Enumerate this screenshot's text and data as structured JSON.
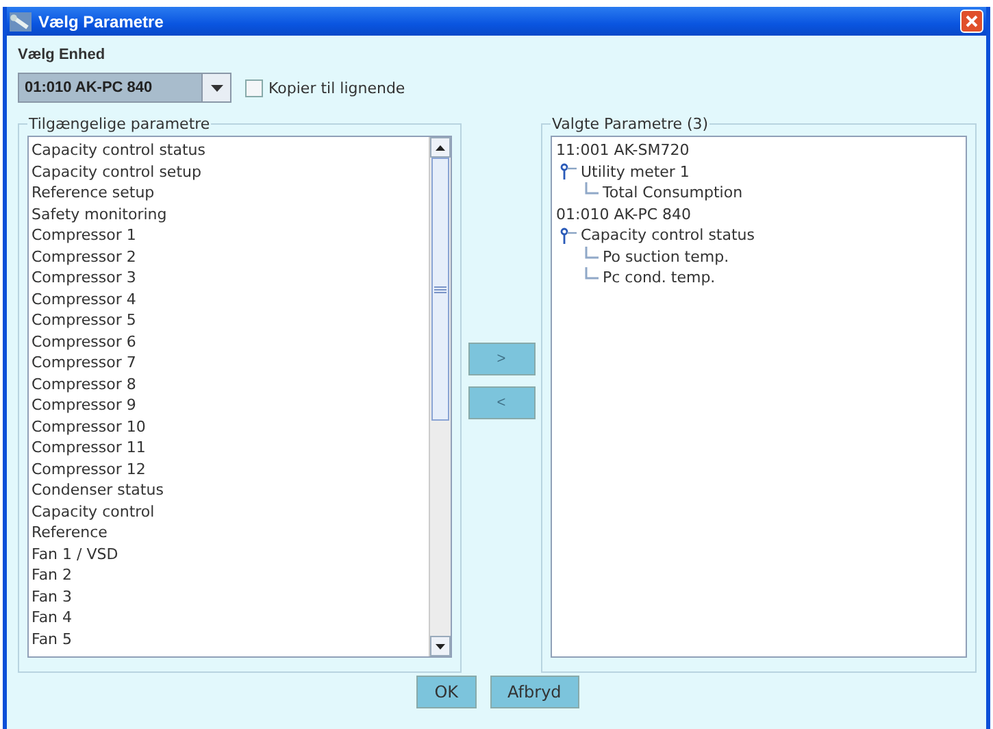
{
  "window": {
    "title": "Vælg Parametre"
  },
  "device": {
    "label": "Vælg Enhed",
    "value": "01:010 AK-PC 840",
    "copy_checkbox": {
      "label": "Kopier til lignende",
      "checked": false
    }
  },
  "available": {
    "title": "Tilgængelige parametre",
    "items": [
      {
        "label": "Capacity control status",
        "selected": false
      },
      {
        "label": "Capacity control setup",
        "selected": false
      },
      {
        "label": "Reference setup",
        "selected": false
      },
      {
        "label": "Safety monitoring",
        "selected": false
      },
      {
        "label": "Compressor 1",
        "selected": false
      },
      {
        "label": "Compressor 2",
        "selected": false
      },
      {
        "label": "Compressor 3",
        "selected": false
      },
      {
        "label": "Compressor 4",
        "selected": false
      },
      {
        "label": "Compressor 5",
        "selected": false
      },
      {
        "label": "Compressor 6",
        "selected": false
      },
      {
        "label": "Compressor 7",
        "selected": false
      },
      {
        "label": "Compressor 8",
        "selected": false
      },
      {
        "label": "Compressor 9",
        "selected": false
      },
      {
        "label": "Compressor 10",
        "selected": false
      },
      {
        "label": "Compressor 11",
        "selected": false
      },
      {
        "label": "Compressor 12",
        "selected": false
      },
      {
        "label": "Condenser status",
        "selected": false
      },
      {
        "label": "Capacity control",
        "selected": false
      },
      {
        "label": "Reference",
        "selected": false
      },
      {
        "label": "Fan 1 / VSD",
        "selected": false
      },
      {
        "label": "Fan 2",
        "selected": false
      },
      {
        "label": "Fan 3",
        "selected": false
      },
      {
        "label": "Fan 4",
        "selected": false
      },
      {
        "label": "Fan 5",
        "selected": false
      }
    ]
  },
  "move_buttons": [
    {
      "label": ">",
      "disabled": true
    },
    {
      "label": "<",
      "disabled": true
    }
  ],
  "chosen": {
    "title": "Valgte Parametre (3)",
    "tree": [
      {
        "label": "11:001 AK-SM720",
        "children": [
          {
            "label": "Utility meter 1",
            "expanded": true,
            "children": [
              {
                "label": "Total Consumption"
              }
            ]
          }
        ]
      },
      {
        "label": "01:010 AK-PC 840",
        "children": [
          {
            "label": "Capacity control status",
            "expanded": true,
            "children": [
              {
                "label": "Po suction temp."
              },
              {
                "label": "Pc cond. temp."
              }
            ]
          }
        ]
      }
    ]
  },
  "buttons": [
    {
      "label": "OK"
    },
    {
      "label": "Afbryd"
    }
  ]
}
